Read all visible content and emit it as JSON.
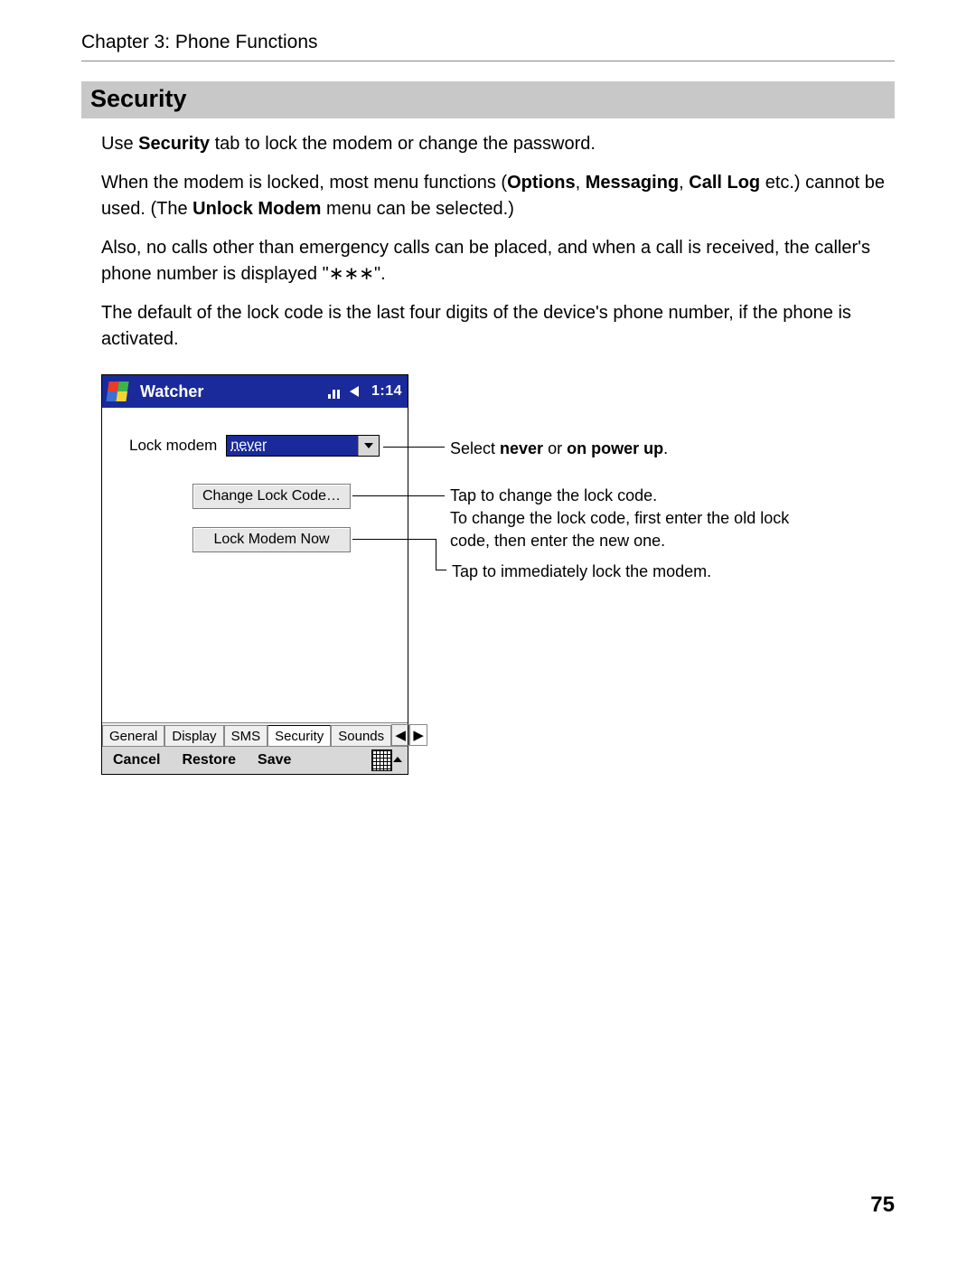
{
  "header": {
    "chapter": "Chapter 3: Phone Functions"
  },
  "section": {
    "title": "Security"
  },
  "paragraphs": {
    "p1_pre": "Use ",
    "p1_bold": "Security",
    "p1_post": " tab to lock the modem or change the password.",
    "p2_a": "When the modem is locked, most menu functions (",
    "p2_b1": "Options",
    "p2_s1": ", ",
    "p2_b2": "Messaging",
    "p2_s2": ", ",
    "p2_b3": "Call Log",
    "p2_c": " etc.) cannot be used. (The ",
    "p2_b4": "Unlock Modem",
    "p2_d": " menu can be selected.)",
    "p3": "Also, no calls other than emergency calls can be placed, and when a call is received, the caller's phone number is displayed \"∗∗∗\".",
    "p4": "The default of the lock code is the last four digits of the device's phone number, if the phone is activated."
  },
  "device": {
    "title": "Watcher",
    "clock": "1:14",
    "lock_label": "Lock modem",
    "lock_value": "never",
    "btn_change": "Change Lock Code…",
    "btn_locknow": "Lock Modem Now",
    "tabs": [
      "General",
      "Display",
      "SMS",
      "Security",
      "Sounds"
    ],
    "cmd": {
      "cancel": "Cancel",
      "restore": "Restore",
      "save": "Save"
    }
  },
  "callouts": {
    "c1_pre": "Select ",
    "c1_b1": "never",
    "c1_mid": " or ",
    "c1_b2": "on power up",
    "c1_post": ".",
    "c2_line1": "Tap to change the lock code.",
    "c2_line2": "To change the lock code, first enter the old lock code, then enter the new one.",
    "c3": "Tap to immediately lock the modem."
  },
  "page_number": "75"
}
